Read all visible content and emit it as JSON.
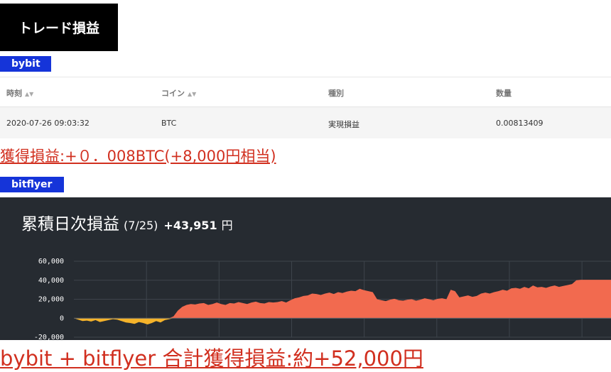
{
  "title": "トレード損益",
  "sections": {
    "bybit_label": "bybit",
    "bitflyer_label": "bitflyer"
  },
  "table": {
    "headers": [
      "時刻",
      "コイン",
      "種別",
      "数量"
    ],
    "sortable": [
      true,
      true,
      false,
      false
    ],
    "rows": [
      [
        "2020-07-26 09:03:32",
        "BTC",
        "実現損益",
        "0.00813409"
      ]
    ]
  },
  "bybit_profit": "獲得損益:+０．008BTC(+8,000円相当)",
  "total_profit": "bybit + bitflyer 合計獲得損益:約+52,000円",
  "chart_data": {
    "type": "area",
    "title": "累積日次損益",
    "subtitle": "(7/25)",
    "value": "+43,951",
    "unit": "円",
    "ylim": [
      -20000,
      60000
    ],
    "yticks": [
      "60,000",
      "40,000",
      "20,000",
      "0",
      "-20,000"
    ],
    "grid": true,
    "colors": {
      "positive": "#f26a4f",
      "negative": "#f5b32a",
      "background": "#262b31"
    },
    "values": [
      0,
      -1500,
      -3000,
      -2500,
      -3500,
      -2000,
      -4000,
      -3000,
      -2000,
      -1000,
      -1500,
      -3000,
      -4500,
      -5000,
      -6000,
      -4000,
      -5000,
      -6500,
      -5000,
      -3000,
      -4500,
      -2000,
      -1000,
      2000,
      8000,
      12000,
      14000,
      15000,
      14500,
      15500,
      16000,
      14000,
      15000,
      16500,
      15000,
      14000,
      16000,
      15500,
      17000,
      16000,
      15000,
      16500,
      17500,
      16000,
      15500,
      17000,
      16500,
      17000,
      18000,
      16500,
      19000,
      21000,
      22000,
      23500,
      24000,
      26000,
      25500,
      24500,
      26000,
      27000,
      25500,
      27500,
      26500,
      28000,
      29000,
      28500,
      31000,
      29500,
      28500,
      27500,
      20000,
      19000,
      18000,
      19500,
      20500,
      19000,
      18500,
      19500,
      20000,
      18500,
      19500,
      21000,
      20000,
      19000,
      20500,
      21000,
      20000,
      30000,
      28500,
      22000,
      23000,
      24000,
      22500,
      23500,
      26000,
      27000,
      26000,
      27500,
      28500,
      30000,
      29000,
      31500,
      32000,
      31000,
      33000,
      31500,
      34500,
      32500,
      33000,
      32000,
      33500,
      34500,
      33000,
      34000,
      35000,
      36000,
      40000,
      40500,
      40500,
      40500,
      40500,
      40500,
      40500,
      40500,
      40500
    ]
  }
}
